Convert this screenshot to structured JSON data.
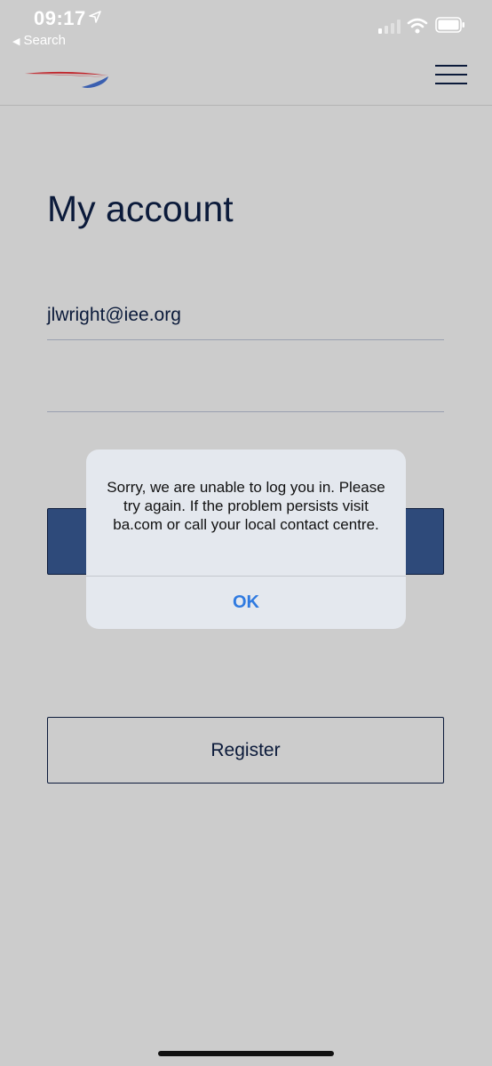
{
  "status_bar": {
    "time": "09:17",
    "back_app_label": "Search",
    "icons": [
      "location-arrow-icon",
      "cellular-signal-icon",
      "wifi-icon",
      "battery-icon"
    ]
  },
  "header": {
    "logo_icon": "speedmarque-logo-icon",
    "menu_icon": "hamburger-menu-icon"
  },
  "main": {
    "title": "My account",
    "email_value": "jlwright@iee.org",
    "password_value": "",
    "login_label": "",
    "register_label": "Register"
  },
  "alert": {
    "message": "Sorry, we are unable to log you in. Please try again. If the problem persists visit ba.com or call your local contact centre.",
    "ok_label": "OK"
  },
  "colors": {
    "background": "#cccccc",
    "navy": "#0b1a3a",
    "login_button": "#2e4a7a",
    "alert_bg": "#e4e8ee",
    "alert_button": "#2f7ae0",
    "logo_red": "#c0272d",
    "logo_blue": "#3a5fb0"
  }
}
